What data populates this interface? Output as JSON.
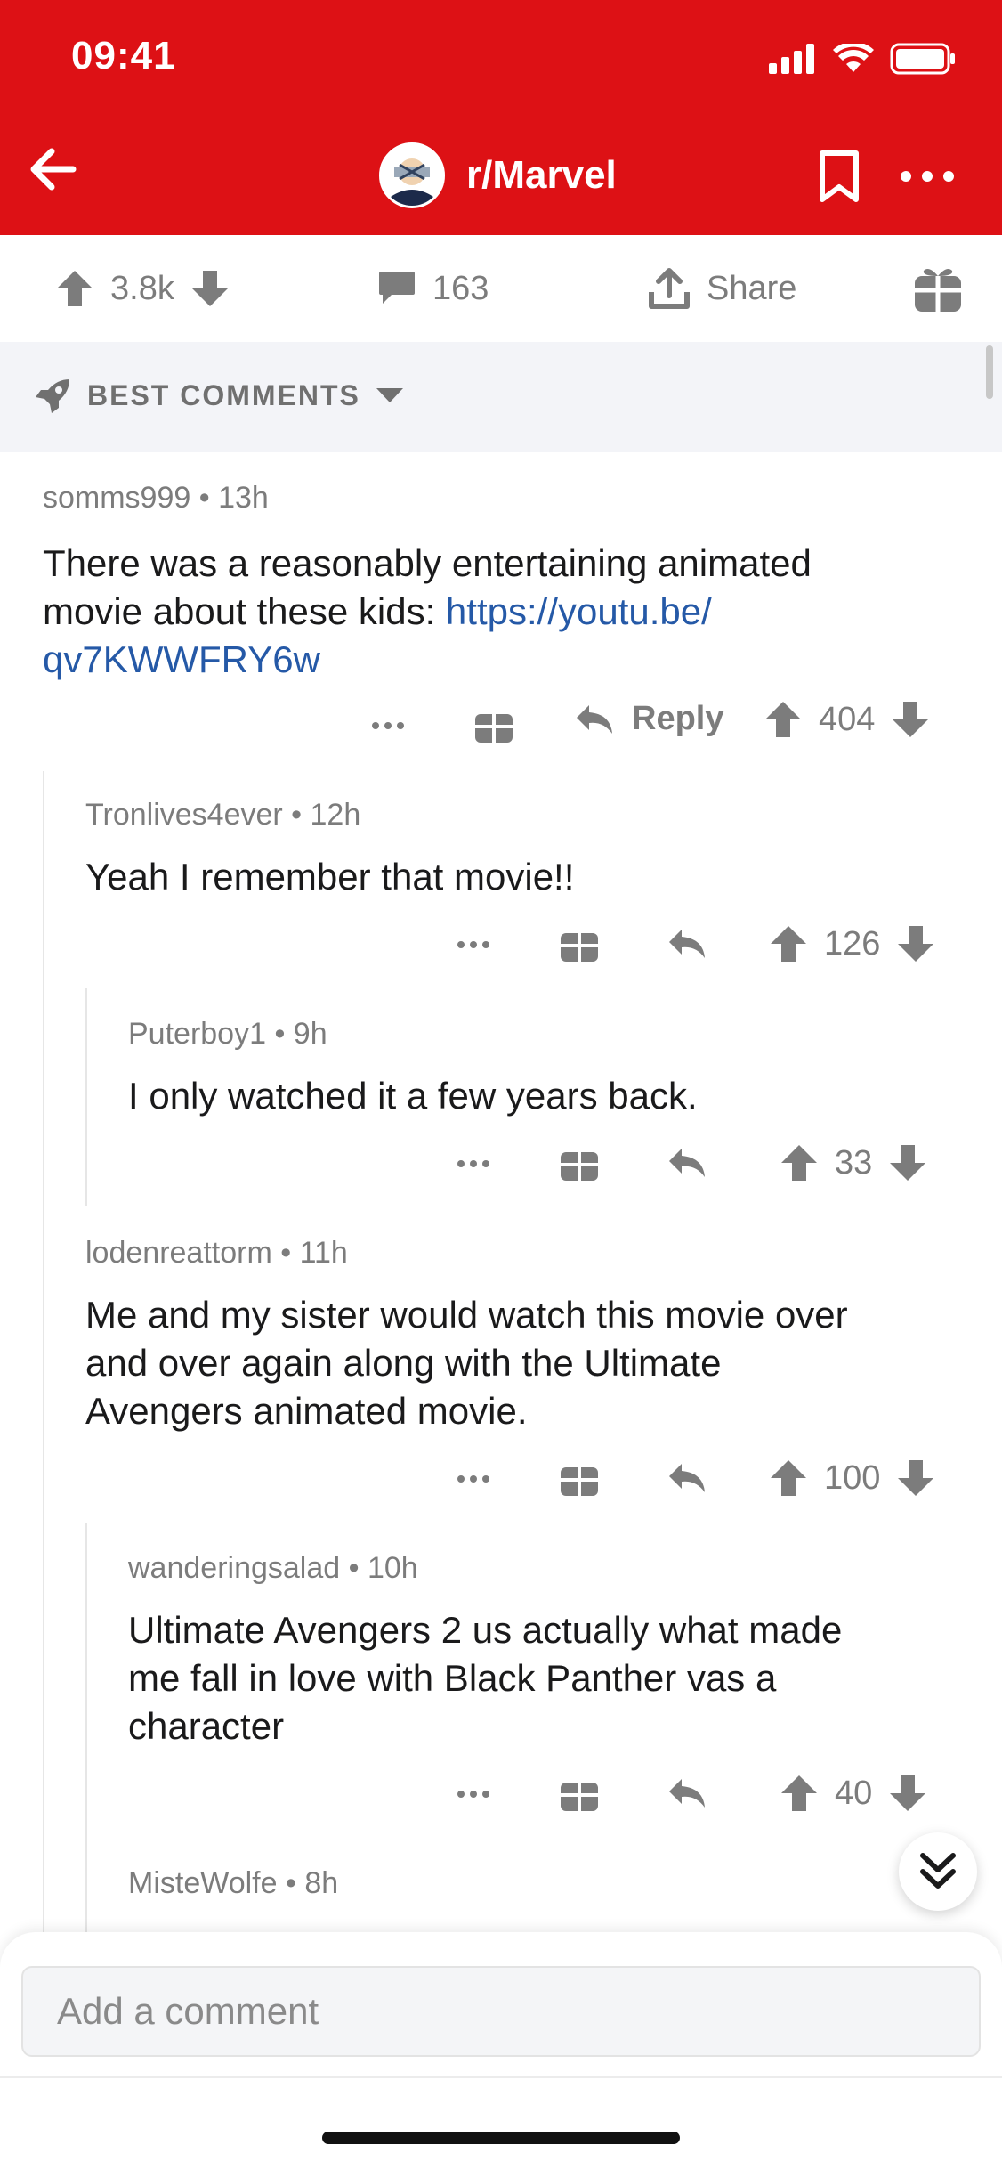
{
  "status_bar": {
    "time": "09:41"
  },
  "header": {
    "subreddit": "r/Marvel"
  },
  "action_bar": {
    "upvotes": "3.8k",
    "comments": "163",
    "share": "Share"
  },
  "sort": {
    "label": "BEST COMMENTS"
  },
  "comments": [
    {
      "author": "somms999",
      "age": "13h",
      "text": "There was a reasonably entertaining animated",
      "text2": "movie about these kids: ",
      "link": "https://youtu.be/",
      "link2": "qv7KWWFRY6w",
      "reply_label": "Reply",
      "score": "404"
    },
    {
      "author": "Tronlives4ever",
      "age": "12h",
      "text": "Yeah I remember that movie!!",
      "score": "126"
    },
    {
      "author": "Puterboy1",
      "age": "9h",
      "text": "I only watched it a few years back.",
      "score": "33"
    },
    {
      "author": "lodenreattorm",
      "age": "11h",
      "text": "Me and my sister would watch this movie over",
      "text2": "and over again along with the Ultimate",
      "text3": "Avengers animated movie.",
      "score": "100"
    },
    {
      "author": "wanderingsalad",
      "age": "10h",
      "text": "Ultimate Avengers 2 us actually what made",
      "text2": "me fall in love with Black Panther vas a",
      "text3": "character",
      "score": "40"
    },
    {
      "author": "MisteWolfe",
      "age": "8h"
    }
  ],
  "composer": {
    "placeholder": "Add a comment"
  },
  "colors": {
    "header": "#DD1115",
    "link": "#2559a7",
    "meta": "#7c7c7c"
  }
}
